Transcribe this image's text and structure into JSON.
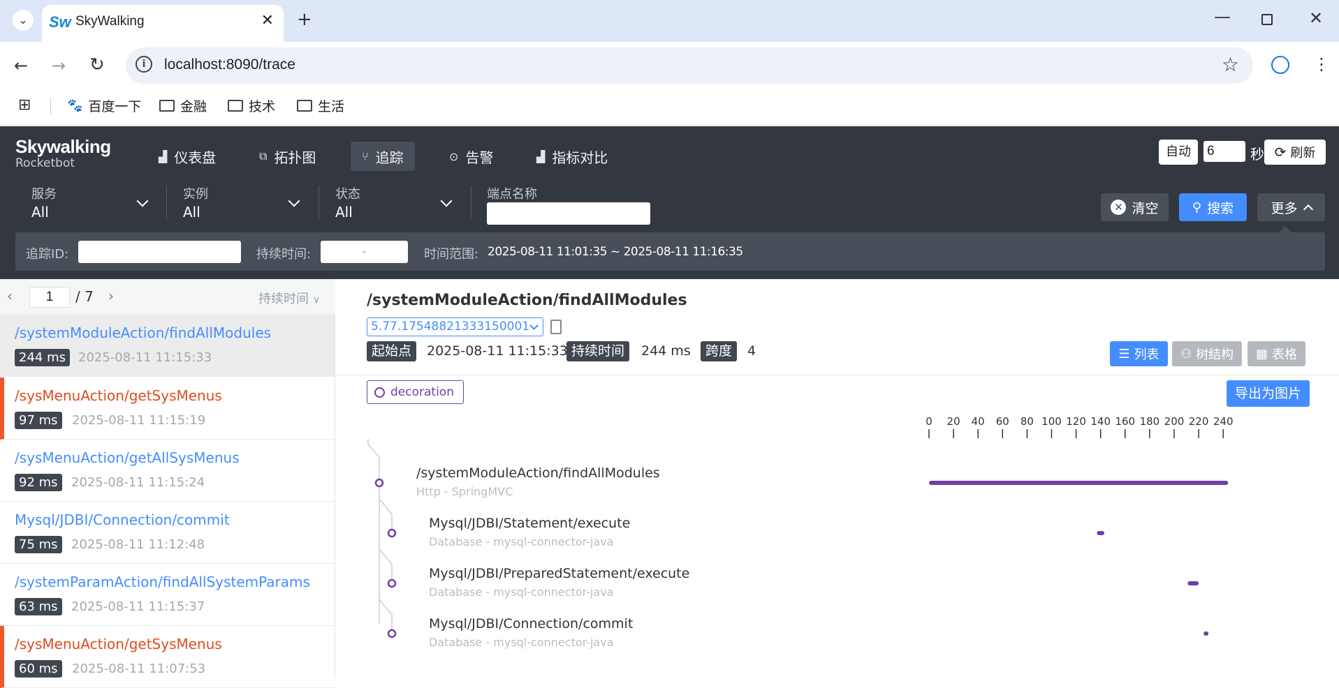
{
  "browser": {
    "tab_title": "SkyWalking",
    "favicon_text": "Sw",
    "url": "localhost:8090/trace",
    "bookmarks": [
      "百度一下",
      "金融",
      "技术",
      "生活"
    ]
  },
  "app": {
    "logo_line1": "Skywalking",
    "logo_line2": "Rocketbot",
    "nav": [
      {
        "label": "仪表盘",
        "icon": "chart-bar-icon"
      },
      {
        "label": "拓扑图",
        "icon": "topology-icon"
      },
      {
        "label": "追踪",
        "icon": "trace-icon",
        "active": true
      },
      {
        "label": "告警",
        "icon": "alarm-icon"
      },
      {
        "label": "指标对比",
        "icon": "compare-icon"
      }
    ],
    "auto_label": "自动",
    "interval_value": "6",
    "seconds_label": "秒",
    "refresh_label": "刷新"
  },
  "filters": {
    "service": {
      "label": "服务",
      "value": "All"
    },
    "instance": {
      "label": "实例",
      "value": "All"
    },
    "status": {
      "label": "状态",
      "value": "All"
    },
    "endpoint_label": "端点名称",
    "clear_label": "清空",
    "search_label": "搜索",
    "more_label": "更多",
    "trace_id_label": "追踪ID:",
    "duration_label": "持续时间:",
    "duration_placeholder": "-",
    "time_range_label": "时间范围:",
    "time_range_value": "2025-08-11 11:01:35 ~ 2025-08-11 11:16:35"
  },
  "list": {
    "page": "1",
    "total": "/ 7",
    "sort_label": "持续时间",
    "items": [
      {
        "name": "/systemModuleAction/findAllModules",
        "duration": "244 ms",
        "time": "2025-08-11 11:15:33",
        "error": false,
        "selected": true
      },
      {
        "name": "/sysMenuAction/getSysMenus",
        "duration": "97 ms",
        "time": "2025-08-11 11:15:19",
        "error": true,
        "selected": false
      },
      {
        "name": "/sysMenuAction/getAllSysMenus",
        "duration": "92 ms",
        "time": "2025-08-11 11:15:24",
        "error": false,
        "selected": false
      },
      {
        "name": "Mysql/JDBI/Connection/commit",
        "duration": "75 ms",
        "time": "2025-08-11 11:12:48",
        "error": false,
        "selected": false
      },
      {
        "name": "/systemParamAction/findAllSystemParams",
        "duration": "63 ms",
        "time": "2025-08-11 11:15:37",
        "error": false,
        "selected": false
      },
      {
        "name": "/sysMenuAction/getSysMenus",
        "duration": "60 ms",
        "time": "2025-08-11 11:07:53",
        "error": true,
        "selected": false
      }
    ]
  },
  "detail": {
    "title": "/systemModuleAction/findAllModules",
    "trace_id": "5.77.17548821333150001",
    "start_label": "起始点",
    "start_value": "2025-08-11 11:15:33",
    "duration_label": "持续时间",
    "duration_value": "244 ms",
    "spans_label": "跨度",
    "spans_value": "4",
    "view_list": "列表",
    "view_tree": "树结构",
    "view_table": "表格",
    "decoration_label": "decoration",
    "export_label": "导出为图片",
    "accent_color": "#6f3fa7",
    "primary_color": "#448dfe",
    "error_color": "#e04b1d"
  },
  "timeline": {
    "axis_ticks": [
      0,
      20,
      40,
      60,
      80,
      100,
      120,
      140,
      160,
      180,
      200,
      220,
      240
    ],
    "axis_max": 244,
    "spans": [
      {
        "name": "/systemModuleAction/findAllModules",
        "sub": "Http - SpringMVC",
        "depth": 0,
        "start": 0,
        "end": 244
      },
      {
        "name": "Mysql/JDBI/Statement/execute",
        "sub": "Database - mysql-connector-java",
        "depth": 1,
        "start": 137,
        "end": 143
      },
      {
        "name": "Mysql/JDBI/PreparedStatement/execute",
        "sub": "Database - mysql-connector-java",
        "depth": 1,
        "start": 211,
        "end": 220
      },
      {
        "name": "Mysql/JDBI/Connection/commit",
        "sub": "Database - mysql-connector-java",
        "depth": 1,
        "start": 224,
        "end": 228
      }
    ]
  }
}
